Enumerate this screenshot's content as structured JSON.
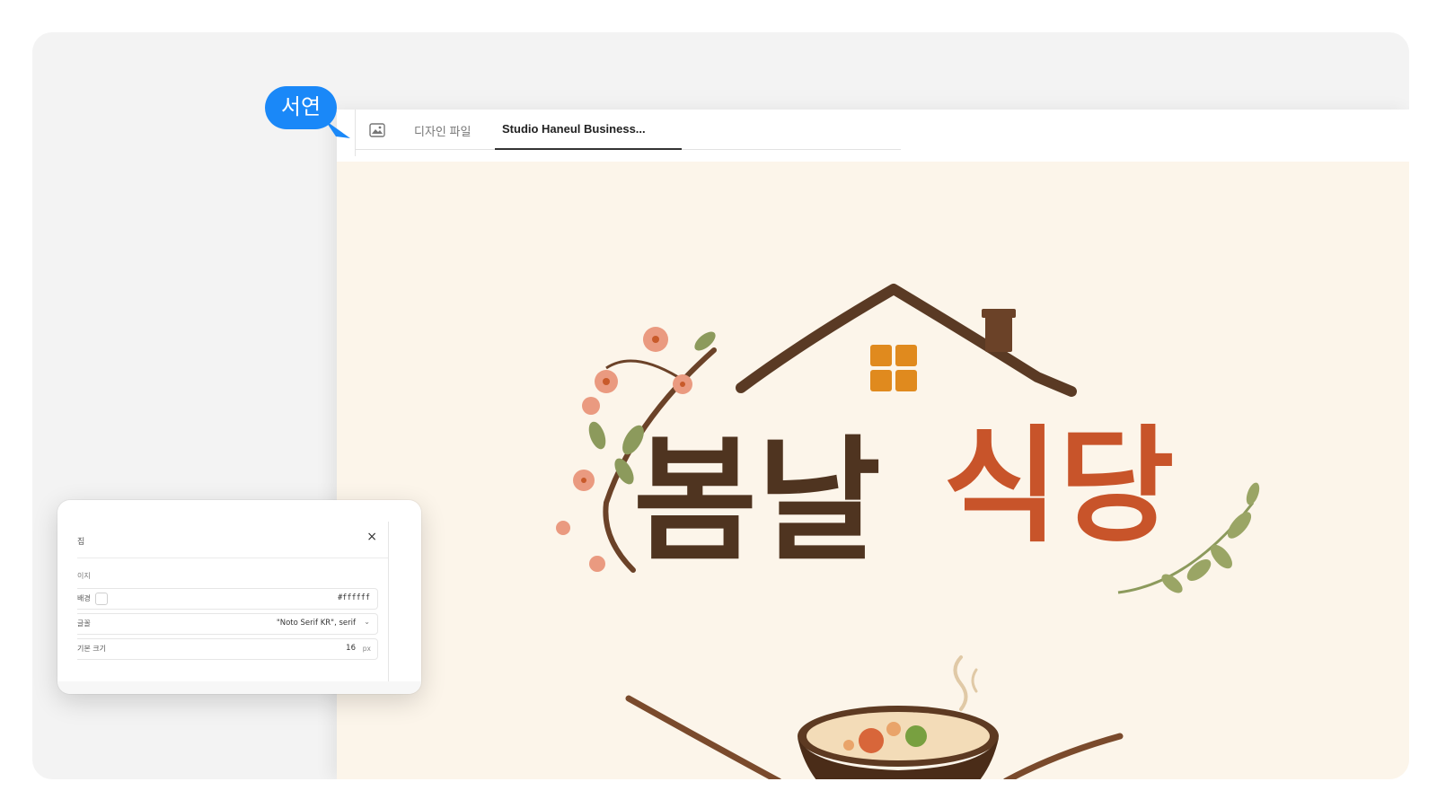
{
  "tabs": {
    "design_file_label": "디자인 파일",
    "active_tab_label": "Studio Haneul Business..."
  },
  "collaborator": {
    "name": "서연",
    "color": "#1a88f8"
  },
  "canvas": {
    "background": "#fcf5ea",
    "logo": {
      "title_dark": "봄날",
      "title_accent": "식당",
      "dark_color": "#4f3420",
      "accent_color": "#c8542a"
    }
  },
  "panel": {
    "title": "집",
    "close_symbol": "×",
    "section_label": "이지",
    "rows": [
      {
        "label": "배경",
        "value": "#ffffff"
      },
      {
        "label": "글꼴",
        "value": "\"Noto Serif KR\", serif"
      },
      {
        "label": "기본 크기",
        "value": "16",
        "unit": "px"
      }
    ]
  },
  "icons": [
    "image-icon",
    "close-icon",
    "chevron-down-icon",
    "color-swatch"
  ]
}
